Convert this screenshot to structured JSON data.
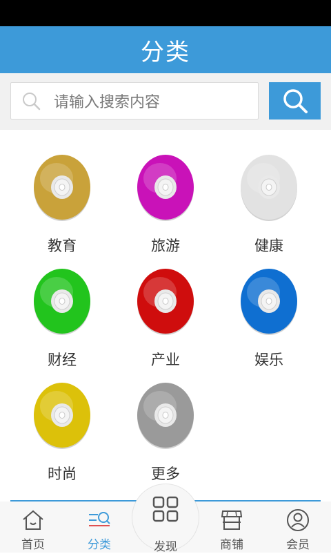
{
  "header": {
    "title": "分类"
  },
  "search": {
    "placeholder": "请输入搜索内容"
  },
  "categories": [
    {
      "label": "教育",
      "color": "#c9a23a"
    },
    {
      "label": "旅游",
      "color": "#c912b8"
    },
    {
      "label": "健康",
      "color": "#e2e2e2"
    },
    {
      "label": "财经",
      "color": "#22c41d"
    },
    {
      "label": "产业",
      "color": "#cf0d0d"
    },
    {
      "label": "娱乐",
      "color": "#0f6fd1"
    },
    {
      "label": "时尚",
      "color": "#dcc10a"
    },
    {
      "label": "更多",
      "color": "#9a9a9a"
    }
  ],
  "tabbar": {
    "home": "首页",
    "category": "分类",
    "discover": "发现",
    "shop": "商铺",
    "member": "会员"
  },
  "colors": {
    "accent": "#3d9ad9"
  }
}
